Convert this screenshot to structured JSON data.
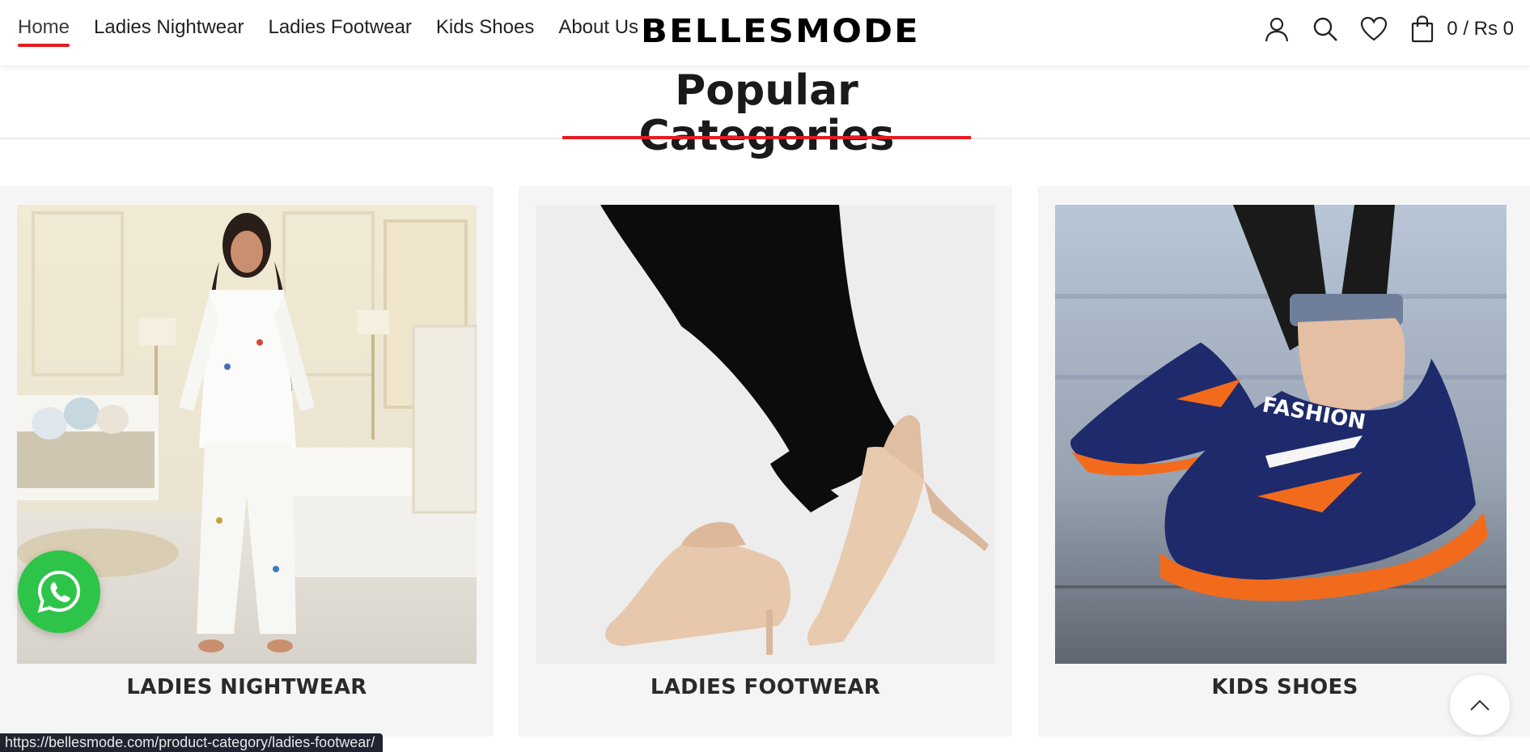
{
  "nav": {
    "items": [
      {
        "label": "Home",
        "active": true
      },
      {
        "label": "Ladies Nightwear",
        "active": false
      },
      {
        "label": "Ladies Footwear",
        "active": false
      },
      {
        "label": "Kids Shoes",
        "active": false
      },
      {
        "label": "About Us",
        "active": false
      }
    ]
  },
  "brand": {
    "logo_text": "BELLESMODE"
  },
  "header_icons": [
    "user-icon",
    "search-icon",
    "heart-icon",
    "shopping-bag-icon"
  ],
  "cart": {
    "total_text": "0 / Rs 0"
  },
  "section": {
    "title": "Popular Categories"
  },
  "categories": [
    {
      "label": "LADIES NIGHTWEAR",
      "image": "woman in white printed pajama set in bedroom"
    },
    {
      "label": "LADIES FOOTWEAR",
      "image": "beige pointed kitten heel pumps with black trousers"
    },
    {
      "label": "KIDS SHOES",
      "image": "navy and orange kids sneakers with FASHION strap"
    }
  ],
  "floating": {
    "whatsapp_icon": "whatsapp-icon",
    "scroll_top_icon": "chevron-up-icon"
  },
  "status_bar": {
    "url": "https://bellesmode.com/product-category/ladies-footwear/"
  },
  "colors": {
    "accent": "#e61b23",
    "whatsapp": "#2ec44a",
    "card_bg": "#f5f5f5"
  }
}
